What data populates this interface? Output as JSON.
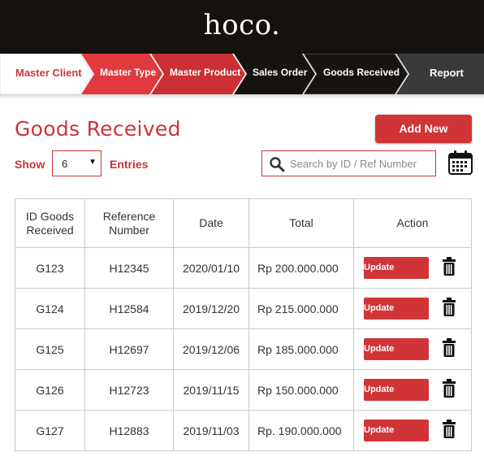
{
  "brand": {
    "logo": "hoco."
  },
  "nav": {
    "steps": [
      {
        "label": "Master Client"
      },
      {
        "label": "Master Type"
      },
      {
        "label": "Master Product"
      },
      {
        "label": "Sales Order"
      },
      {
        "label": "Goods Received"
      },
      {
        "label": "Report"
      }
    ],
    "active": "Goods Received"
  },
  "page": {
    "title": "Goods Received",
    "add_label": "Add New",
    "show_label": "Show",
    "entries_value": "6",
    "entries_label": "Entries",
    "search_placeholder": "Search by ID / Ref Number"
  },
  "table": {
    "headers": [
      "ID Goods Received",
      "Reference Number",
      "Date",
      "Total",
      "Action"
    ],
    "update_label": "Update",
    "rows": [
      {
        "id": "G123",
        "ref": "H12345",
        "date": "2020/01/10",
        "total": "Rp 200.000.000"
      },
      {
        "id": "G124",
        "ref": "H12584",
        "date": "2019/12/20",
        "total": "Rp 215.000.000"
      },
      {
        "id": "G125",
        "ref": "H12697",
        "date": "2019/12/06",
        "total": "Rp 185.000.000"
      },
      {
        "id": "G126",
        "ref": "H12723",
        "date": "2019/11/15",
        "total": "Rp 150.000.000"
      },
      {
        "id": "G127",
        "ref": "H12883",
        "date": "2019/11/03",
        "total": "Rp. 190.000.000"
      }
    ]
  },
  "colors": {
    "accent": "#d13437",
    "header_bg": "#15110f",
    "title": "#c8363b"
  }
}
